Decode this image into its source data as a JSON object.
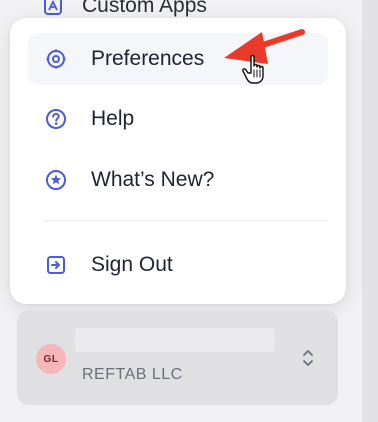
{
  "background_item": {
    "label": "Custom Apps",
    "icon": "custom-apps-icon"
  },
  "menu": {
    "items": [
      {
        "label": "Preferences",
        "icon": "gear-icon",
        "state": "hovered"
      },
      {
        "label": "Help",
        "icon": "help-circle-icon"
      },
      {
        "label": "What’s New?",
        "icon": "star-circle-icon"
      },
      {
        "label": "Sign Out",
        "icon": "sign-out-icon"
      }
    ]
  },
  "org_switcher": {
    "avatar_initials": "GL",
    "org_name": "REFTAB LLC",
    "icon": "chevron-up-down-icon"
  },
  "colors": {
    "accent_icon": "#4a5dd6",
    "annotation_arrow": "#e8392b",
    "avatar_bg": "#f4b6b8"
  }
}
